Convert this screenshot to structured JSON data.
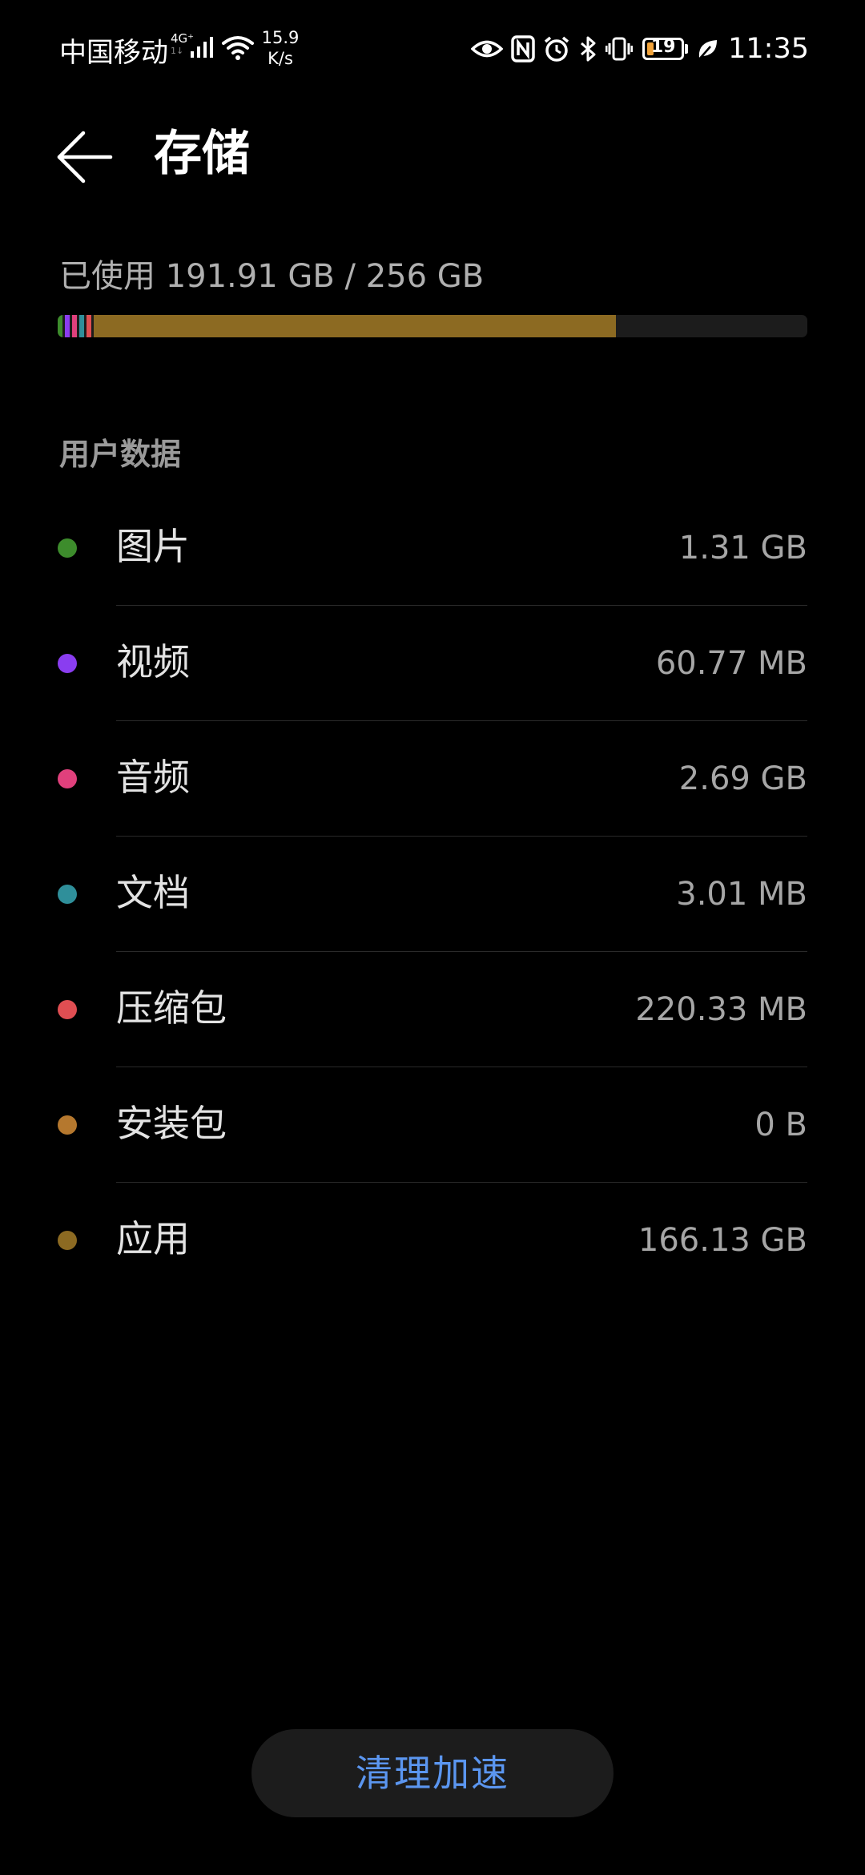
{
  "status_bar": {
    "carrier": "中国移动",
    "network_type": "4G⁺",
    "network_sub": "1↓",
    "net_speed_value": "15.9",
    "net_speed_unit": "K/s",
    "battery": "19",
    "battery_level": 0.19,
    "battery_color": "#f2a33a",
    "time": "11:35",
    "icons": [
      "eye-comfort-icon",
      "nfc-icon",
      "alarm-icon",
      "bluetooth-icon",
      "vibrate-icon",
      "battery-icon",
      "power-saving-leaf-icon"
    ]
  },
  "header": {
    "title": "存储",
    "back_icon": "arrow-left-icon"
  },
  "usage": {
    "text": "已使用 191.91 GB / 256 GB",
    "used_fraction": 0.7497,
    "segments": [
      {
        "name": "图片",
        "color": "#3d8c2c",
        "fraction": 0.006
      },
      {
        "name": "视频",
        "color": "#8a3df0",
        "fraction": 0.006
      },
      {
        "name": "音频",
        "color": "#e0407c",
        "fraction": 0.006
      },
      {
        "name": "文档",
        "color": "#2f8f9a",
        "fraction": 0.006
      },
      {
        "name": "压缩包",
        "color": "#e04e52",
        "fraction": 0.006
      },
      {
        "name": "应用",
        "color": "#8c6a22",
        "fraction": 0.6967
      }
    ],
    "track_color": "#1c1c1c"
  },
  "section": {
    "title": "用户数据"
  },
  "categories": [
    {
      "label": "图片",
      "size": "1.31 GB",
      "color": "#3d8c2c"
    },
    {
      "label": "视频",
      "size": "60.77 MB",
      "color": "#8a3df0"
    },
    {
      "label": "音频",
      "size": "2.69 GB",
      "color": "#e0407c"
    },
    {
      "label": "文档",
      "size": "3.01 MB",
      "color": "#2f8f9a"
    },
    {
      "label": "压缩包",
      "size": "220.33 MB",
      "color": "#e04e52"
    },
    {
      "label": "安装包",
      "size": "0 B",
      "color": "#b5782e"
    },
    {
      "label": "应用",
      "size": "166.13 GB",
      "color": "#8c6a22"
    }
  ],
  "actions": {
    "clean_label": "清理加速",
    "clean_color": "#5b96f0"
  }
}
